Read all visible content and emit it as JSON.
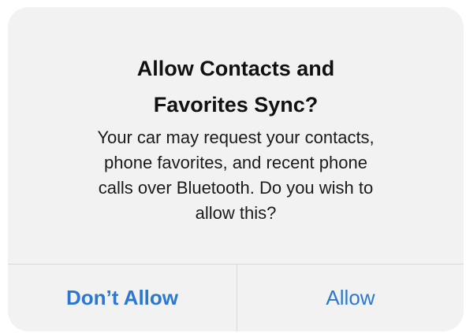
{
  "alert": {
    "title_lines": [
      "Allow Contacts and",
      "Favorites Sync?"
    ],
    "message_lines": [
      "Your car may request your contacts,",
      "phone favorites, and recent phone",
      "calls over Bluetooth. Do you wish to",
      "allow this?"
    ],
    "buttons": {
      "deny_label": "Don’t Allow",
      "allow_label": "Allow"
    }
  },
  "colors": {
    "button_text": "#2c78d0",
    "alert_background": "#f2f2f2",
    "divider": "#d9d9d9"
  }
}
